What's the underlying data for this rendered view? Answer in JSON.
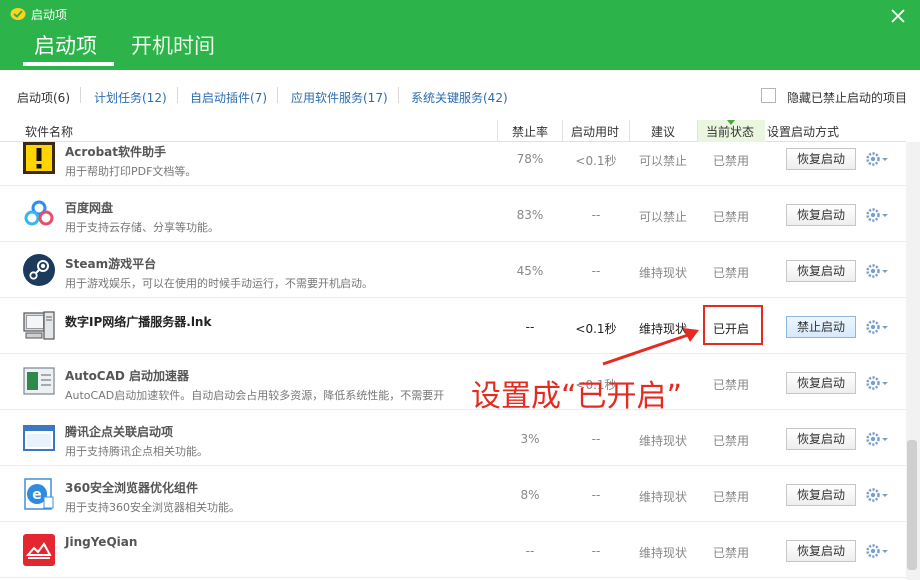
{
  "window": {
    "title": "启动项",
    "tabs": [
      "启动项",
      "开机时间"
    ]
  },
  "subtabs": [
    "启动项(6)",
    "计划任务(12)",
    "自启动插件(7)",
    "应用软件服务(17)",
    "系统关键服务(42)"
  ],
  "hide_disabled_label": "隐藏已禁止启动的项目",
  "columns": {
    "name": "软件名称",
    "rate": "禁止率",
    "time": "启动用时",
    "advice": "建议",
    "state": "当前状态",
    "action": "设置启动方式"
  },
  "rows": [
    {
      "name": "Acrobat软件助手",
      "desc": "用于帮助打印PDF文档等。",
      "rate": "78%",
      "time": "<0.1秒",
      "advice": "可以禁止",
      "state": "已禁用",
      "button": "恢复启动",
      "icon": "acrobat-icon"
    },
    {
      "name": "百度网盘",
      "desc": "用于支持云存储、分享等功能。",
      "rate": "83%",
      "time": "--",
      "advice": "可以禁止",
      "state": "已禁用",
      "button": "恢复启动",
      "icon": "baidu-netdisk-icon"
    },
    {
      "name": "Steam游戏平台",
      "desc": "用于游戏娱乐，可以在使用的时候手动运行，不需要开机启动。",
      "rate": "45%",
      "time": "--",
      "advice": "维持现状",
      "state": "已禁用",
      "button": "恢复启动",
      "icon": "steam-icon"
    },
    {
      "name": "数字IP网络广播服务器.lnk",
      "desc": "",
      "rate": "--",
      "time": "<0.1秒",
      "advice": "维持现状",
      "state": "已开启",
      "button": "禁止启动",
      "icon": "computer-icon"
    },
    {
      "name": "AutoCAD 启动加速器",
      "desc": "AutoCAD启动加速软件。自动启动会占用较多资源，降低系统性能，不需要开",
      "rate": "",
      "time": "<0.1秒",
      "advice": "",
      "state": "已禁用",
      "button": "恢复启动",
      "icon": "autocad-icon"
    },
    {
      "name": "腾讯企点关联启动项",
      "desc": "用于支持腾讯企点相关功能。",
      "rate": "3%",
      "time": "--",
      "advice": "维持现状",
      "state": "已禁用",
      "button": "恢复启动",
      "icon": "window-icon"
    },
    {
      "name": "360安全浏览器优化组件",
      "desc": "用于支持360安全浏览器相关功能。",
      "rate": "8%",
      "time": "--",
      "advice": "维持现状",
      "state": "已禁用",
      "button": "恢复启动",
      "icon": "360-browser-icon"
    },
    {
      "name": "JingYeQian",
      "desc": "",
      "rate": "--",
      "time": "--",
      "advice": "维持现状",
      "state": "已禁用",
      "button": "恢复启动",
      "icon": "jingyeqian-icon"
    }
  ],
  "annotation": "设置成“已开启”",
  "colors": {
    "header": "#2cb34a",
    "link": "#2a6db0",
    "annotation": "#e52b20"
  }
}
